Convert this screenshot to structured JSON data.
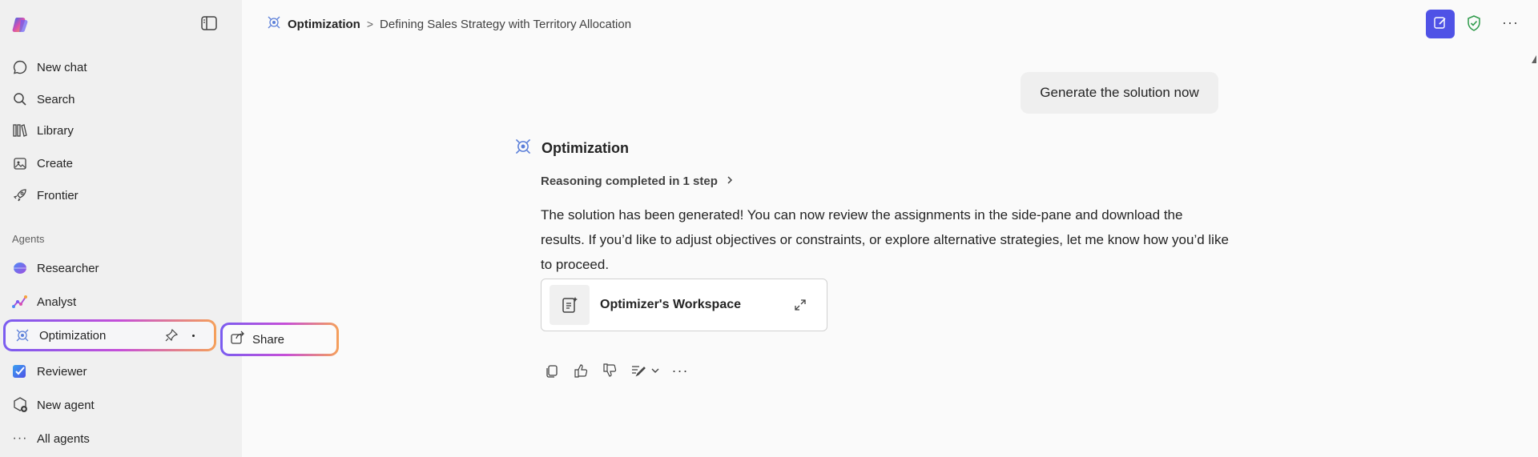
{
  "sidebar": {
    "nav": [
      {
        "label": "New chat",
        "icon": "chat-icon"
      },
      {
        "label": "Search",
        "icon": "search-icon"
      },
      {
        "label": "Library",
        "icon": "library-icon"
      },
      {
        "label": "Create",
        "icon": "create-icon"
      },
      {
        "label": "Frontier",
        "icon": "rocket-icon"
      }
    ],
    "agents_label": "Agents",
    "agents": [
      {
        "label": "Researcher",
        "icon": "researcher-icon"
      },
      {
        "label": "Analyst",
        "icon": "analyst-icon"
      },
      {
        "label": "Optimization",
        "icon": "optimization-icon"
      },
      {
        "label": "Reviewer",
        "icon": "reviewer-icon"
      },
      {
        "label": "New agent",
        "icon": "new-agent-icon"
      },
      {
        "label": "All agents",
        "icon": "more-icon"
      }
    ]
  },
  "context_menu": {
    "share_label": "Share"
  },
  "header": {
    "agent": "Optimization",
    "separator": ">",
    "conversation_title": "Defining Sales Strategy with Territory Allocation"
  },
  "chat": {
    "user_message": "Generate the solution now",
    "bot_name": "Optimization",
    "reasoning": "Reasoning completed in 1 step",
    "answer": "The solution has been generated! You can now review the assignments in the side-pane and download the results. If you’d like to adjust objectives or constraints, or explore alternative strategies, let me know how you’d like to proceed.",
    "workspace_label": "Optimizer's Workspace"
  },
  "colors": {
    "accent": "#4f52e6",
    "highlight_gradient": [
      "#7a5cf0",
      "#c64fd8",
      "#f5a05a"
    ],
    "shield": "#2e9a4a"
  }
}
